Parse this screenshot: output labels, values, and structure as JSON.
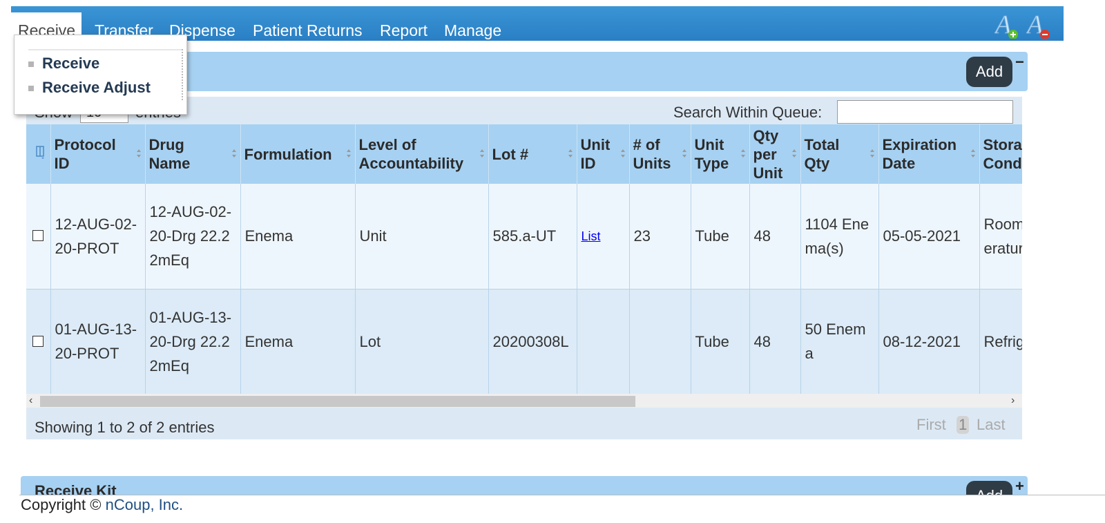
{
  "nav": {
    "items": [
      "Receive",
      "Transfer",
      "Dispense",
      "Patient Returns",
      "Report",
      "Manage"
    ],
    "active": "Receive",
    "font_increase_icon": "font-increase-icon",
    "font_decrease_icon": "font-decrease-icon"
  },
  "dropdown": {
    "items": [
      "Receive",
      "Receive Adjust"
    ]
  },
  "panel": {
    "add_label": "Add",
    "collapse_symbol": "−"
  },
  "table_controls": {
    "show_label": "Show",
    "length_value": "10",
    "entries_label": "entries",
    "search_label": "Search Within Queue:",
    "search_value": ""
  },
  "table": {
    "columns": [
      "Protocol ID",
      "Drug Name",
      "Formulation",
      "Level of Accountability",
      "Lot #",
      "Unit ID",
      "# of Units",
      "Unit Type",
      "Qty per Unit",
      "Total Qty",
      "Expiration Date",
      "Storage Conditions"
    ],
    "rows": [
      {
        "protocol_id": "12-AUG-02-20-PROT",
        "drug_name": "12-AUG-02-20-Drg 22.22mEq",
        "formulation": "Enema",
        "level": "Unit",
        "lot": "585.a-UT",
        "unit_id": "List",
        "units": "23",
        "unit_type": "Tube",
        "qty_per_unit": "48",
        "total_qty": "1104 Enema(s)",
        "expiration": "05-05-2021",
        "storage": "Room Temperature"
      },
      {
        "protocol_id": "01-AUG-13-20-PROT",
        "drug_name": "01-AUG-13-20-Drg 22.22mEq",
        "formulation": "Enema",
        "level": "Lot",
        "lot": "20200308L",
        "unit_id": "",
        "units": "",
        "unit_type": "Tube",
        "qty_per_unit": "48",
        "total_qty": "50 Enema",
        "expiration": "08-12-2021",
        "storage": "Refrigerated"
      }
    ]
  },
  "table_footer": {
    "info": "Showing 1 to 2 of 2 entries",
    "first": "First",
    "page": "1",
    "last": "Last"
  },
  "receive_kit": {
    "title": "Receive Kit",
    "add_label": "Add",
    "expand_symbol": "+"
  },
  "footer": {
    "copyright": "Copyright ©",
    "company": "nCoup, Inc."
  },
  "colors": {
    "nav_bg": "#2a7fc4",
    "panel_bg": "#a6d1f2",
    "add_button": "#2f3c46",
    "link": "#0000ee"
  }
}
